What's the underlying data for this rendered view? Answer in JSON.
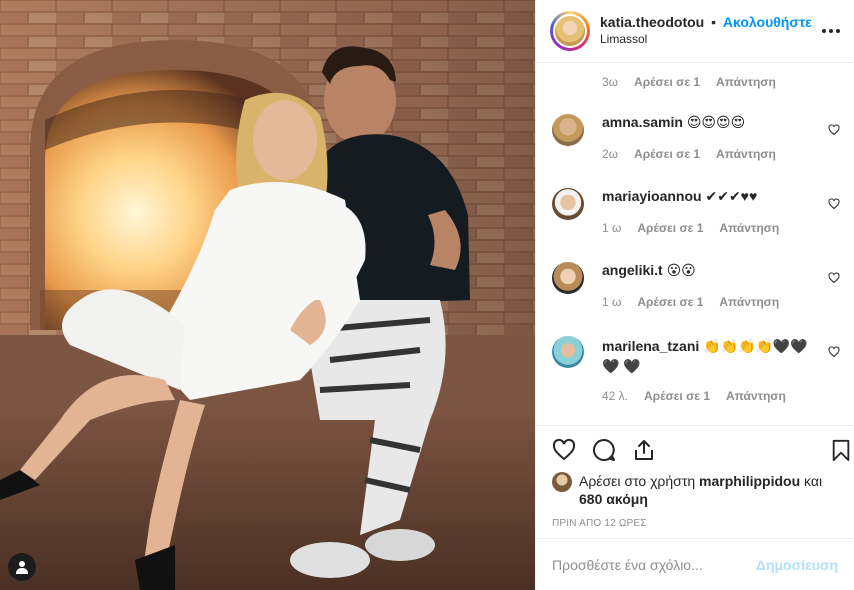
{
  "post": {
    "image_alt": "",
    "user_tag_icon": "person-icon"
  },
  "header": {
    "username": "katia.theodotou",
    "separator": "•",
    "follow_label": "Ακολουθήστε",
    "location": "Limassol",
    "more_icon": "more-dots-icon"
  },
  "first_comment_meta": {
    "time": "3ω",
    "likes": "Αρέσει σε 1",
    "reply": "Απάντηση"
  },
  "comments": [
    {
      "username": "amna.samin",
      "text": "😍😍😍😍",
      "time": "2ω",
      "likes": "Αρέσει σε 1",
      "reply": "Απάντηση"
    },
    {
      "username": "mariayioannou",
      "text": "✔✔✔♥♥",
      "time": "1 ω",
      "likes": "Αρέσει σε 1",
      "reply": "Απάντηση"
    },
    {
      "username": "angeliki.t",
      "text": "😮😮",
      "time": "1 ω",
      "likes": "Αρέσει σε 1",
      "reply": "Απάντηση"
    },
    {
      "username": "marilena_tzani",
      "text": "👏👏👏👏🖤🖤🖤 🖤",
      "time": "42 λ.",
      "likes": "Αρέσει σε 1",
      "reply": "Απάντηση"
    }
  ],
  "actions": {
    "like_icon": "heart-icon",
    "comment_icon": "comment-bubble-icon",
    "share_icon": "share-icon",
    "save_icon": "bookmark-icon"
  },
  "likes_summary": {
    "prefix": "Αρέσει στο χρήστη",
    "user": "marphilippidou",
    "conj": "και",
    "count": "680 ακόμη"
  },
  "timestamp": "ΠΡΙΝ ΑΠΟ 12 ΩΡΕΣ",
  "add_comment": {
    "placeholder": "Προσθέστε ένα σχόλιο...",
    "post_label": "Δημοσίευση"
  },
  "colors": {
    "link_blue": "#0095f6",
    "post_disabled": "#b2dffc",
    "muted": "#8e8e8e",
    "text": "#262626"
  }
}
